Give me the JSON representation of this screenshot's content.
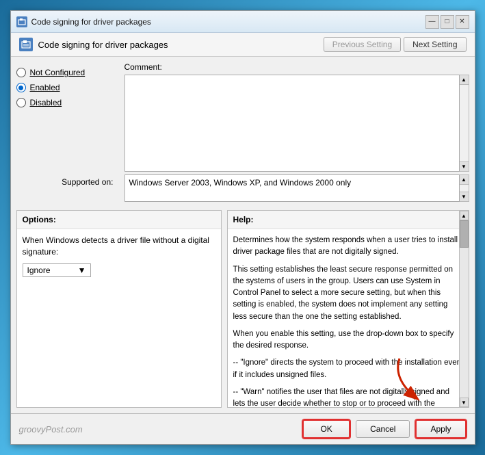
{
  "window": {
    "title": "Code signing for driver packages",
    "header_title": "Code signing for driver packages"
  },
  "nav": {
    "prev_label": "Previous Setting",
    "next_label": "Next Setting"
  },
  "config": {
    "not_configured_label": "Not Configured",
    "enabled_label": "Enabled",
    "disabled_label": "Disabled",
    "selected": "enabled"
  },
  "comment": {
    "label": "Comment:"
  },
  "supported": {
    "label": "Supported on:",
    "value": "Windows Server 2003, Windows XP, and Windows 2000 only"
  },
  "options": {
    "header": "Options:",
    "description": "When Windows detects a driver file without a digital signature:",
    "dropdown_value": "Ignore",
    "dropdown_arrow": "▼"
  },
  "help": {
    "header": "Help:",
    "paragraphs": [
      "Determines how the system responds when a user tries to install driver package files that are not digitally signed.",
      "This setting establishes the least secure response permitted on the systems of users in the group. Users can use System in Control Panel to select a more secure setting, but when this setting is enabled, the system does not implement any setting less secure than the one the setting established.",
      "When you enable this setting, use the drop-down box to specify the desired response.",
      "-- \"Ignore\" directs the system to proceed with the installation even if it includes unsigned files.",
      "-- \"Warn\" notifies the user that files are not digitally signed and lets the user decide whether to stop or to proceed with the installation and whether to permit unsigned files to be installed. \"Warn\" is the default."
    ]
  },
  "footer": {
    "ok_label": "OK",
    "cancel_label": "Cancel",
    "apply_label": "Apply",
    "watermark": "groovyPost.com"
  },
  "title_controls": {
    "minimize": "—",
    "maximize": "□",
    "close": "✕"
  }
}
